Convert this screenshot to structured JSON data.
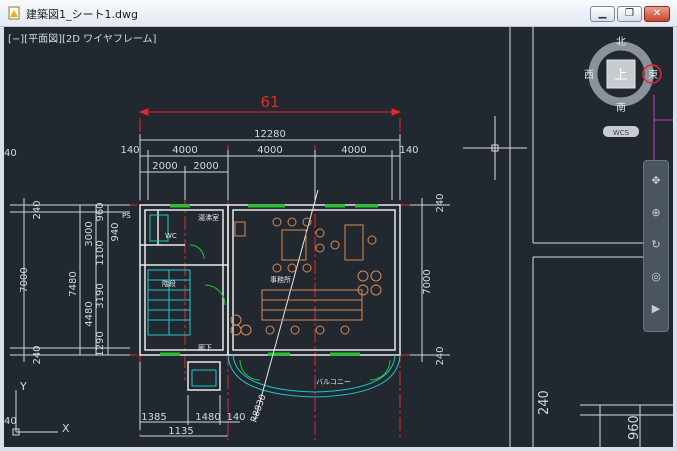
{
  "window": {
    "title": "建築図1_シート1.dwg",
    "minimize": "▁",
    "restore": "❐",
    "close": "✕"
  },
  "view_label": "[−][平面図][2D ワイヤフレーム]",
  "viewcube": {
    "north": "北",
    "south": "南",
    "west": "西",
    "east": "東",
    "face": "上",
    "wcs": "WCS"
  },
  "drawing": {
    "overall_label": "61",
    "top_total": "12280",
    "top_dims": [
      "140",
      "4000",
      "4000",
      "4000",
      "140"
    ],
    "top_sub_dims": [
      "2000",
      "2000"
    ],
    "left_dims": [
      "240",
      "7000",
      "240"
    ],
    "left_inner_dims": [
      "3000",
      "960",
      "940",
      "1100",
      "7480",
      "4480",
      "3190",
      "1290"
    ],
    "right_dims": [
      "240",
      "7000",
      "240"
    ],
    "bottom_dims": [
      "1385",
      "1480",
      "140",
      "1135"
    ],
    "room_labels": [
      "PS",
      "WC",
      "湯沸室",
      "階段",
      "事務所",
      "廊下",
      "バルコニー"
    ],
    "radius_label": "R8830",
    "edge_labels": [
      "40",
      "40",
      "240",
      "960"
    ],
    "axis_y": "Y",
    "axis_x": "X"
  },
  "nav_tools": [
    "pan-icon",
    "zoom-icon",
    "orbit-icon",
    "steering-icon",
    "show-motion-icon"
  ],
  "colors": {
    "background": "#212830",
    "dim_red": "#e8262d",
    "wall": "#e8e8e8",
    "green": "#22c42b",
    "cyan": "#1ec8c8",
    "furniture": "#d88a56"
  }
}
